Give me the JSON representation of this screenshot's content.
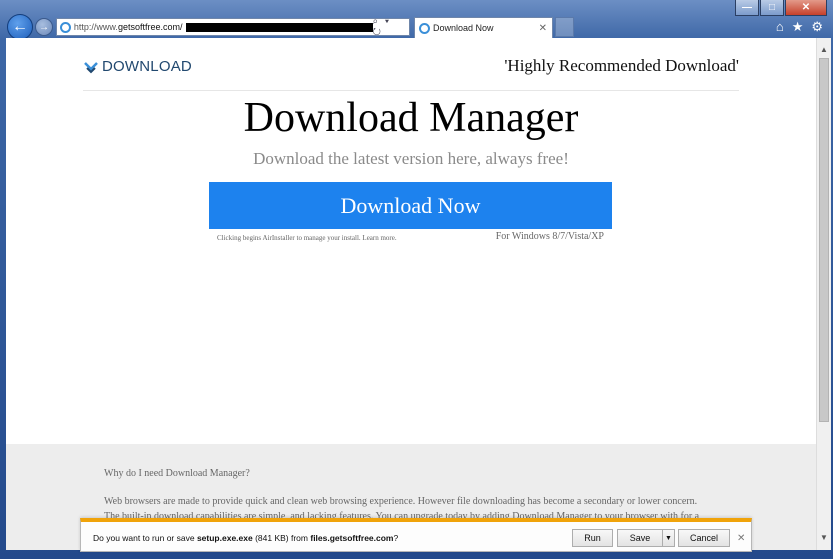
{
  "browser": {
    "url_prefix": "http://www.",
    "url_domain": "getsoftfree.com/",
    "tab_title": "Download Now",
    "caption": {
      "minimize": "—",
      "maximize": "□",
      "close": "✕"
    },
    "icons": [
      "home-icon",
      "favorites-star-icon",
      "settings-gear-icon"
    ],
    "address_tools": "⌕ ▾ ↻"
  },
  "page": {
    "logo_text": "DOWNLOAD",
    "tagline": "'Highly Recommended Download'",
    "title": "Download Manager",
    "subtitle": "Download the latest version here, always free!",
    "cta_label": "Download Now",
    "cta_note": "Clicking begins AirInstaller to manage your install. Learn more.",
    "cta_os": "For Windows 8/7/Vista/XP",
    "faq_question": "Why do I need Download Manager?",
    "faq_answer": "Web browsers are made to provide quick and clean web browsing experience. However file downloading has become a secondary or lower concern. The built-in download capabilities are simple, and lacking features. You can upgrade today by adding Download Manager to your browser with for a richer,"
  },
  "notification": {
    "prefix": "Do you want to run or save ",
    "file": "setup.exe.exe",
    "size": " (841 KB) from ",
    "source": "files.getsoftfree.com",
    "suffix": "?",
    "run_label": "Run",
    "save_label": "Save",
    "cancel_label": "Cancel"
  },
  "colors": {
    "cta": "#1d82ee",
    "notification_accent": "#f0a30a",
    "logo": "#21486f"
  }
}
